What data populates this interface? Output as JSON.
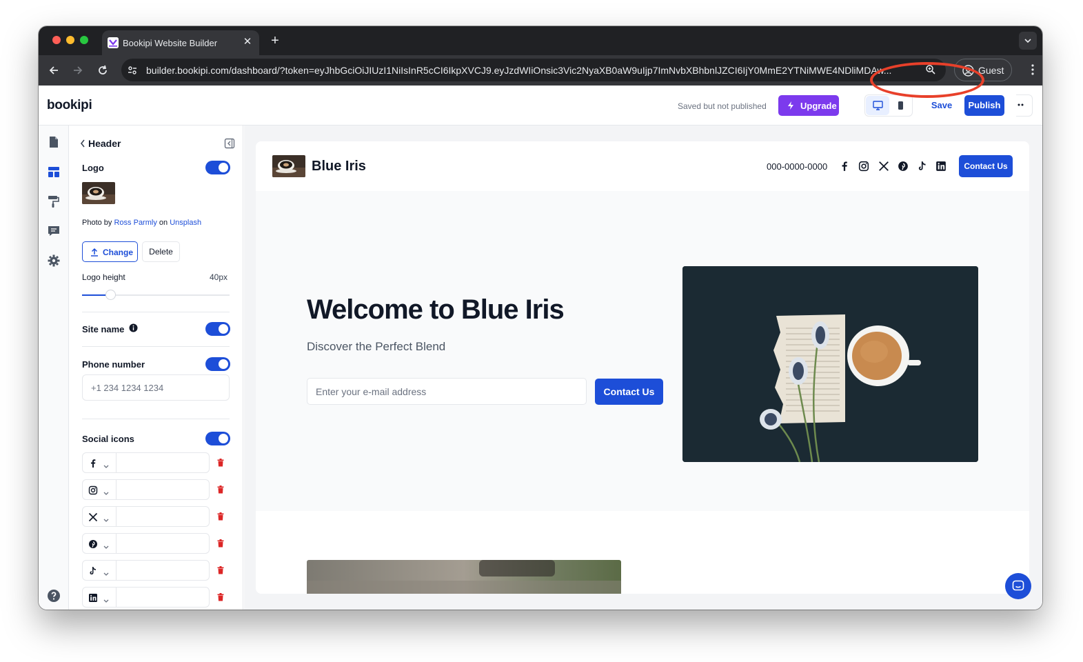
{
  "browser": {
    "tab_title": "Bookipi Website Builder",
    "url": "builder.bookipi.com/dashboard/?token=eyJhbGciOiJIUzI1NiIsInR5cCI6IkpXVCJ9.eyJzdWIiOnsic3Vic2NyaXB0aW9uIjp7ImNvbXBhbnlJZCI6IjY0MmE2YTNiMWE4NDliMDAw...",
    "profile_label": "Guest"
  },
  "app": {
    "logo": "bookipi",
    "status": "Saved but not published",
    "upgrade_label": "Upgrade",
    "save_label": "Save",
    "publish_label": "Publish"
  },
  "panel": {
    "title": "Header",
    "logo_label": "Logo",
    "logo_enabled": true,
    "credit_prefix": "Photo by",
    "credit_author": "Ross Parmly",
    "credit_on": "on",
    "credit_source": "Unsplash",
    "change_label": "Change",
    "delete_label": "Delete",
    "logo_height_label": "Logo height",
    "logo_height_value": "40px",
    "logo_height_fraction": 0.19,
    "site_name_label": "Site name",
    "site_name_enabled": true,
    "phone_label": "Phone number",
    "phone_enabled": true,
    "phone_placeholder": "+1 234 1234 1234",
    "social_label": "Social icons",
    "social_enabled": true,
    "social_items": [
      "facebook-icon",
      "instagram-icon",
      "x-icon",
      "pinterest-icon",
      "tiktok-icon",
      "linkedin-icon"
    ]
  },
  "site": {
    "name": "Blue Iris",
    "phone": "000-0000-0000",
    "header_contact_label": "Contact Us",
    "hero_title": "Welcome to Blue Iris",
    "hero_subtitle": "Discover the Perfect Blend",
    "email_placeholder": "Enter your e-mail address",
    "hero_button_label": "Contact Us"
  },
  "colors": {
    "primary": "#1d4ed8",
    "upgrade": "#7c3aed",
    "highlight": "#e8402a",
    "delete": "#dc2626"
  }
}
